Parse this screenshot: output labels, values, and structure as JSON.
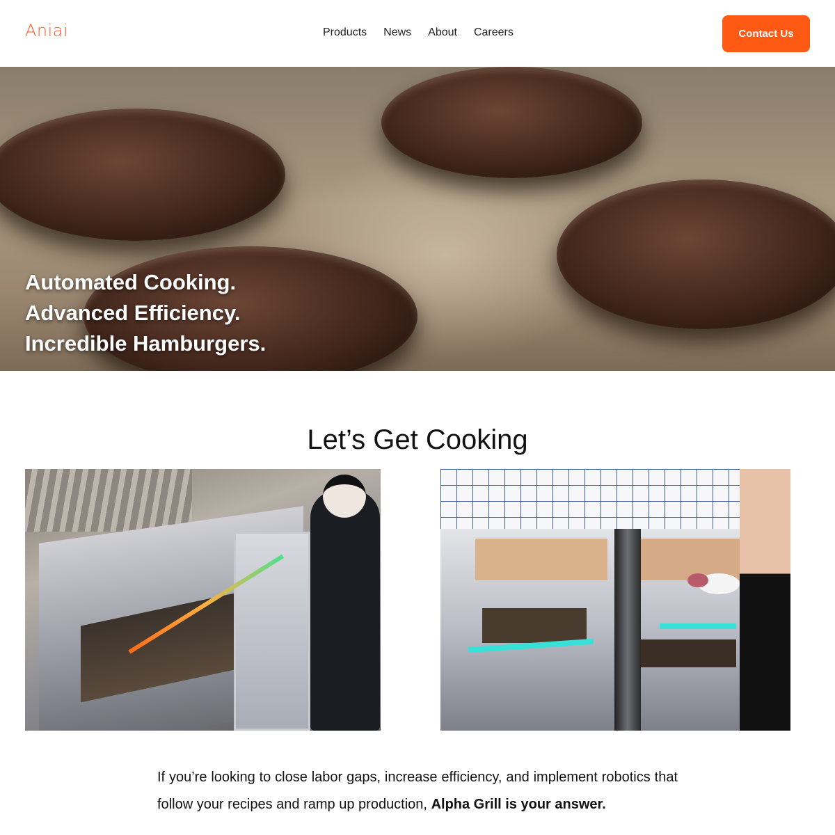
{
  "header": {
    "logo": "Aniai",
    "nav": [
      "Products",
      "News",
      "About",
      "Careers"
    ],
    "contact_label": "Contact Us"
  },
  "hero": {
    "lines": [
      "Automated Cooking.",
      "Advanced Efficiency.",
      "Incredible Hamburgers."
    ]
  },
  "section": {
    "title": "Let’s Get Cooking",
    "body_text": "If you’re looking to close labor gaps, increase efficiency, and implement robotics that follow your recipes and ramp up production,",
    "body_strong": "Alpha Grill is your answer."
  },
  "colors": {
    "accent": "#ff5a14",
    "logo": "#ff5a1f"
  }
}
